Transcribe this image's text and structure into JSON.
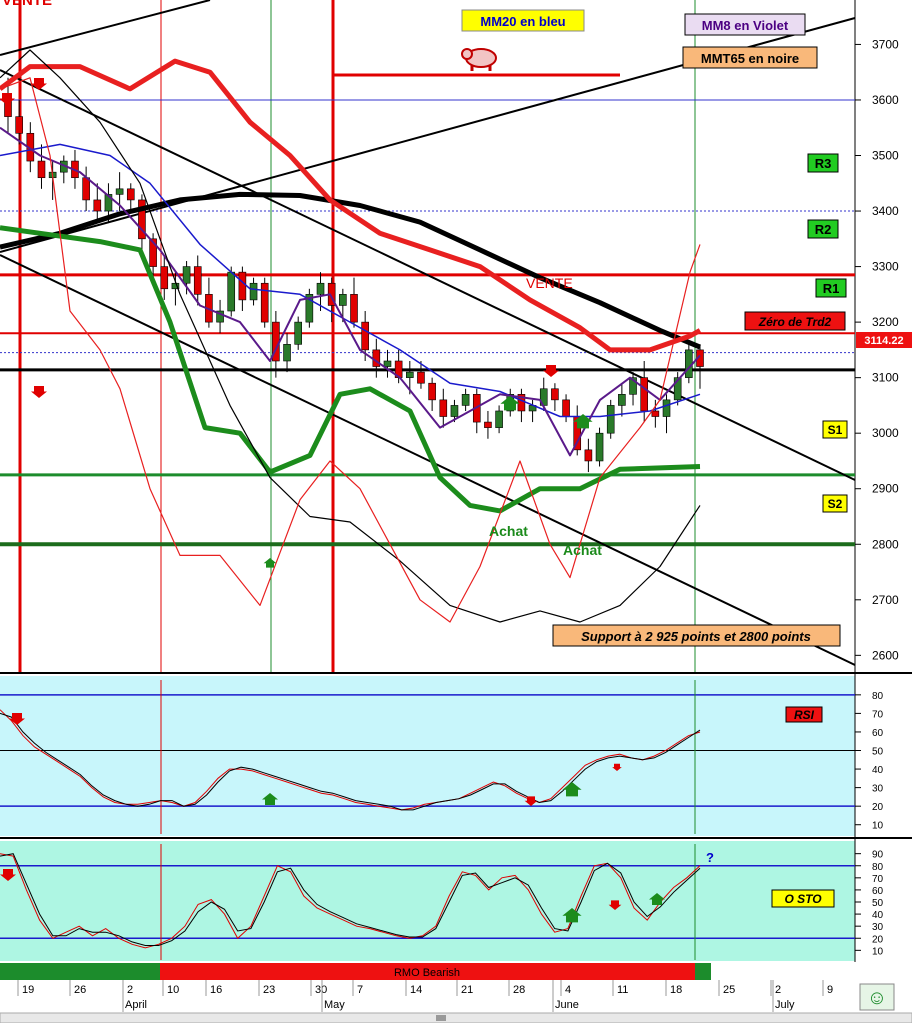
{
  "chart_data": [
    {
      "type": "candlestick",
      "ylim": [
        2570,
        3780
      ],
      "y_ticks": [
        2600,
        2700,
        2800,
        2900,
        3000,
        3100,
        3200,
        3300,
        3400,
        3500,
        3600,
        3700
      ],
      "price_tag": "3114.22",
      "top_left_label": "VENTE",
      "legend": [
        {
          "label": "MM20 en bleu",
          "color": "#0000cc"
        },
        {
          "label": "MM8 en Violet",
          "color": "#4b0082"
        },
        {
          "label": "MMT65 en noire",
          "color": "#000000"
        }
      ],
      "levels": [
        {
          "label": "R3",
          "value": 3400
        },
        {
          "label": "R2",
          "value": 3285
        },
        {
          "label": "R1",
          "value": 3180
        },
        {
          "label": "Zéro de Trd2",
          "value": 3145
        },
        {
          "label": "S1",
          "value": 2925
        },
        {
          "label": "S2",
          "value": 2800
        }
      ],
      "annotations": {
        "vente": "VENTE",
        "achat_1": "Achat",
        "achat_2": "Achat",
        "support": "Support à 2 925 points et 2800 points"
      },
      "candles": [
        [
          3600,
          3640,
          3540,
          3570
        ],
        [
          3570,
          3600,
          3520,
          3540
        ],
        [
          3540,
          3560,
          3470,
          3490
        ],
        [
          3490,
          3520,
          3440,
          3460
        ],
        [
          3460,
          3490,
          3420,
          3470
        ],
        [
          3470,
          3500,
          3450,
          3490
        ],
        [
          3490,
          3510,
          3440,
          3460
        ],
        [
          3460,
          3480,
          3400,
          3420
        ],
        [
          3420,
          3450,
          3380,
          3400
        ],
        [
          3400,
          3450,
          3380,
          3430
        ],
        [
          3430,
          3470,
          3400,
          3440
        ],
        [
          3440,
          3450,
          3400,
          3420
        ],
        [
          3420,
          3430,
          3330,
          3350
        ],
        [
          3350,
          3360,
          3280,
          3300
        ],
        [
          3300,
          3320,
          3240,
          3260
        ],
        [
          3260,
          3290,
          3230,
          3270
        ],
        [
          3270,
          3310,
          3250,
          3300
        ],
        [
          3300,
          3320,
          3230,
          3250
        ],
        [
          3250,
          3280,
          3190,
          3200
        ],
        [
          3200,
          3240,
          3180,
          3220
        ],
        [
          3220,
          3300,
          3210,
          3290
        ],
        [
          3290,
          3300,
          3220,
          3240
        ],
        [
          3240,
          3280,
          3230,
          3270
        ],
        [
          3270,
          3280,
          3190,
          3200
        ],
        [
          3200,
          3220,
          3100,
          3130
        ],
        [
          3130,
          3180,
          3110,
          3160
        ],
        [
          3160,
          3210,
          3150,
          3200
        ],
        [
          3200,
          3260,
          3190,
          3250
        ],
        [
          3250,
          3290,
          3220,
          3270
        ],
        [
          3270,
          3280,
          3200,
          3230
        ],
        [
          3230,
          3260,
          3200,
          3250
        ],
        [
          3250,
          3280,
          3190,
          3200
        ],
        [
          3200,
          3220,
          3130,
          3150
        ],
        [
          3150,
          3170,
          3100,
          3120
        ],
        [
          3120,
          3150,
          3100,
          3130
        ],
        [
          3130,
          3150,
          3090,
          3100
        ],
        [
          3100,
          3130,
          3070,
          3110
        ],
        [
          3110,
          3130,
          3080,
          3090
        ],
        [
          3090,
          3100,
          3040,
          3060
        ],
        [
          3060,
          3080,
          3010,
          3030
        ],
        [
          3030,
          3060,
          3020,
          3050
        ],
        [
          3050,
          3080,
          3040,
          3070
        ],
        [
          3070,
          3080,
          3000,
          3020
        ],
        [
          3020,
          3040,
          2990,
          3010
        ],
        [
          3010,
          3050,
          3000,
          3040
        ],
        [
          3040,
          3080,
          3030,
          3070
        ],
        [
          3070,
          3080,
          3020,
          3040
        ],
        [
          3040,
          3060,
          3020,
          3050
        ],
        [
          3050,
          3100,
          3040,
          3080
        ],
        [
          3080,
          3090,
          3040,
          3060
        ],
        [
          3060,
          3070,
          3020,
          3030
        ],
        [
          3030,
          3050,
          2960,
          2970
        ],
        [
          2970,
          2990,
          2930,
          2950
        ],
        [
          2950,
          3010,
          2940,
          3000
        ],
        [
          3000,
          3060,
          2990,
          3050
        ],
        [
          3050,
          3090,
          3030,
          3070
        ],
        [
          3070,
          3110,
          3050,
          3100
        ],
        [
          3100,
          3130,
          3020,
          3040
        ],
        [
          3040,
          3060,
          3010,
          3030
        ],
        [
          3030,
          3070,
          3000,
          3060
        ],
        [
          3060,
          3110,
          3050,
          3100
        ],
        [
          3100,
          3160,
          3090,
          3150
        ],
        [
          3150,
          3160,
          3080,
          3120
        ]
      ]
    },
    {
      "type": "line",
      "title": "RSI",
      "ylim": [
        5,
        88
      ],
      "y_ticks": [
        10,
        20,
        30,
        40,
        50,
        60,
        70,
        80
      ],
      "levels": [
        80,
        50,
        20
      ],
      "series_a": [
        72,
        66,
        58,
        52,
        48,
        44,
        40,
        36,
        30,
        25,
        22,
        21,
        21,
        22,
        23,
        22,
        20,
        22,
        28,
        35,
        40,
        40,
        39,
        37,
        35,
        33,
        31,
        29,
        27,
        26,
        24,
        22,
        21,
        20,
        19,
        18,
        19,
        21,
        22,
        23,
        24,
        27,
        30,
        33,
        31,
        27,
        24,
        22,
        24,
        30,
        36,
        42,
        45,
        47,
        48,
        46,
        45,
        47,
        50,
        54,
        58,
        60
      ],
      "series_b": [
        70,
        68,
        60,
        54,
        49,
        45,
        41,
        37,
        31,
        26,
        23,
        21,
        20,
        21,
        23,
        23,
        20,
        21,
        26,
        33,
        39,
        41,
        40,
        38,
        36,
        34,
        32,
        30,
        28,
        27,
        25,
        23,
        22,
        21,
        20,
        18,
        18,
        20,
        22,
        23,
        24,
        26,
        29,
        32,
        32,
        28,
        25,
        22,
        23,
        28,
        34,
        40,
        44,
        46,
        47,
        46,
        45,
        46,
        49,
        53,
        57,
        61
      ]
    },
    {
      "type": "line",
      "title": "O STO",
      "ylim": [
        2,
        98
      ],
      "y_ticks": [
        10,
        20,
        30,
        40,
        50,
        60,
        70,
        80,
        90
      ],
      "levels": [
        80,
        20
      ],
      "question_mark": "?",
      "series_a": [
        90,
        88,
        60,
        35,
        20,
        25,
        30,
        22,
        28,
        20,
        15,
        12,
        15,
        20,
        30,
        48,
        52,
        40,
        20,
        30,
        55,
        80,
        75,
        55,
        45,
        40,
        35,
        30,
        28,
        25,
        22,
        20,
        22,
        30,
        55,
        75,
        72,
        60,
        70,
        72,
        60,
        40,
        25,
        28,
        55,
        80,
        82,
        70,
        45,
        35,
        50,
        62,
        70,
        80
      ],
      "series_b": [
        88,
        90,
        65,
        40,
        22,
        22,
        28,
        25,
        25,
        22,
        17,
        14,
        14,
        18,
        26,
        42,
        50,
        44,
        26,
        28,
        50,
        75,
        78,
        60,
        48,
        42,
        37,
        32,
        29,
        26,
        23,
        21,
        21,
        28,
        50,
        72,
        74,
        62,
        66,
        70,
        64,
        45,
        28,
        26,
        50,
        76,
        82,
        74,
        50,
        38,
        46,
        58,
        68,
        78
      ]
    }
  ],
  "rmo_label": "RMO Bearish",
  "date_axis": {
    "days": [
      "19",
      "26",
      "2",
      "10",
      "16",
      "23",
      "30",
      "7",
      "14",
      "21",
      "28",
      "4",
      "11",
      "18",
      "25",
      "2",
      "9"
    ],
    "months": [
      "April",
      "May",
      "June",
      "July"
    ]
  },
  "smiley": "☺"
}
